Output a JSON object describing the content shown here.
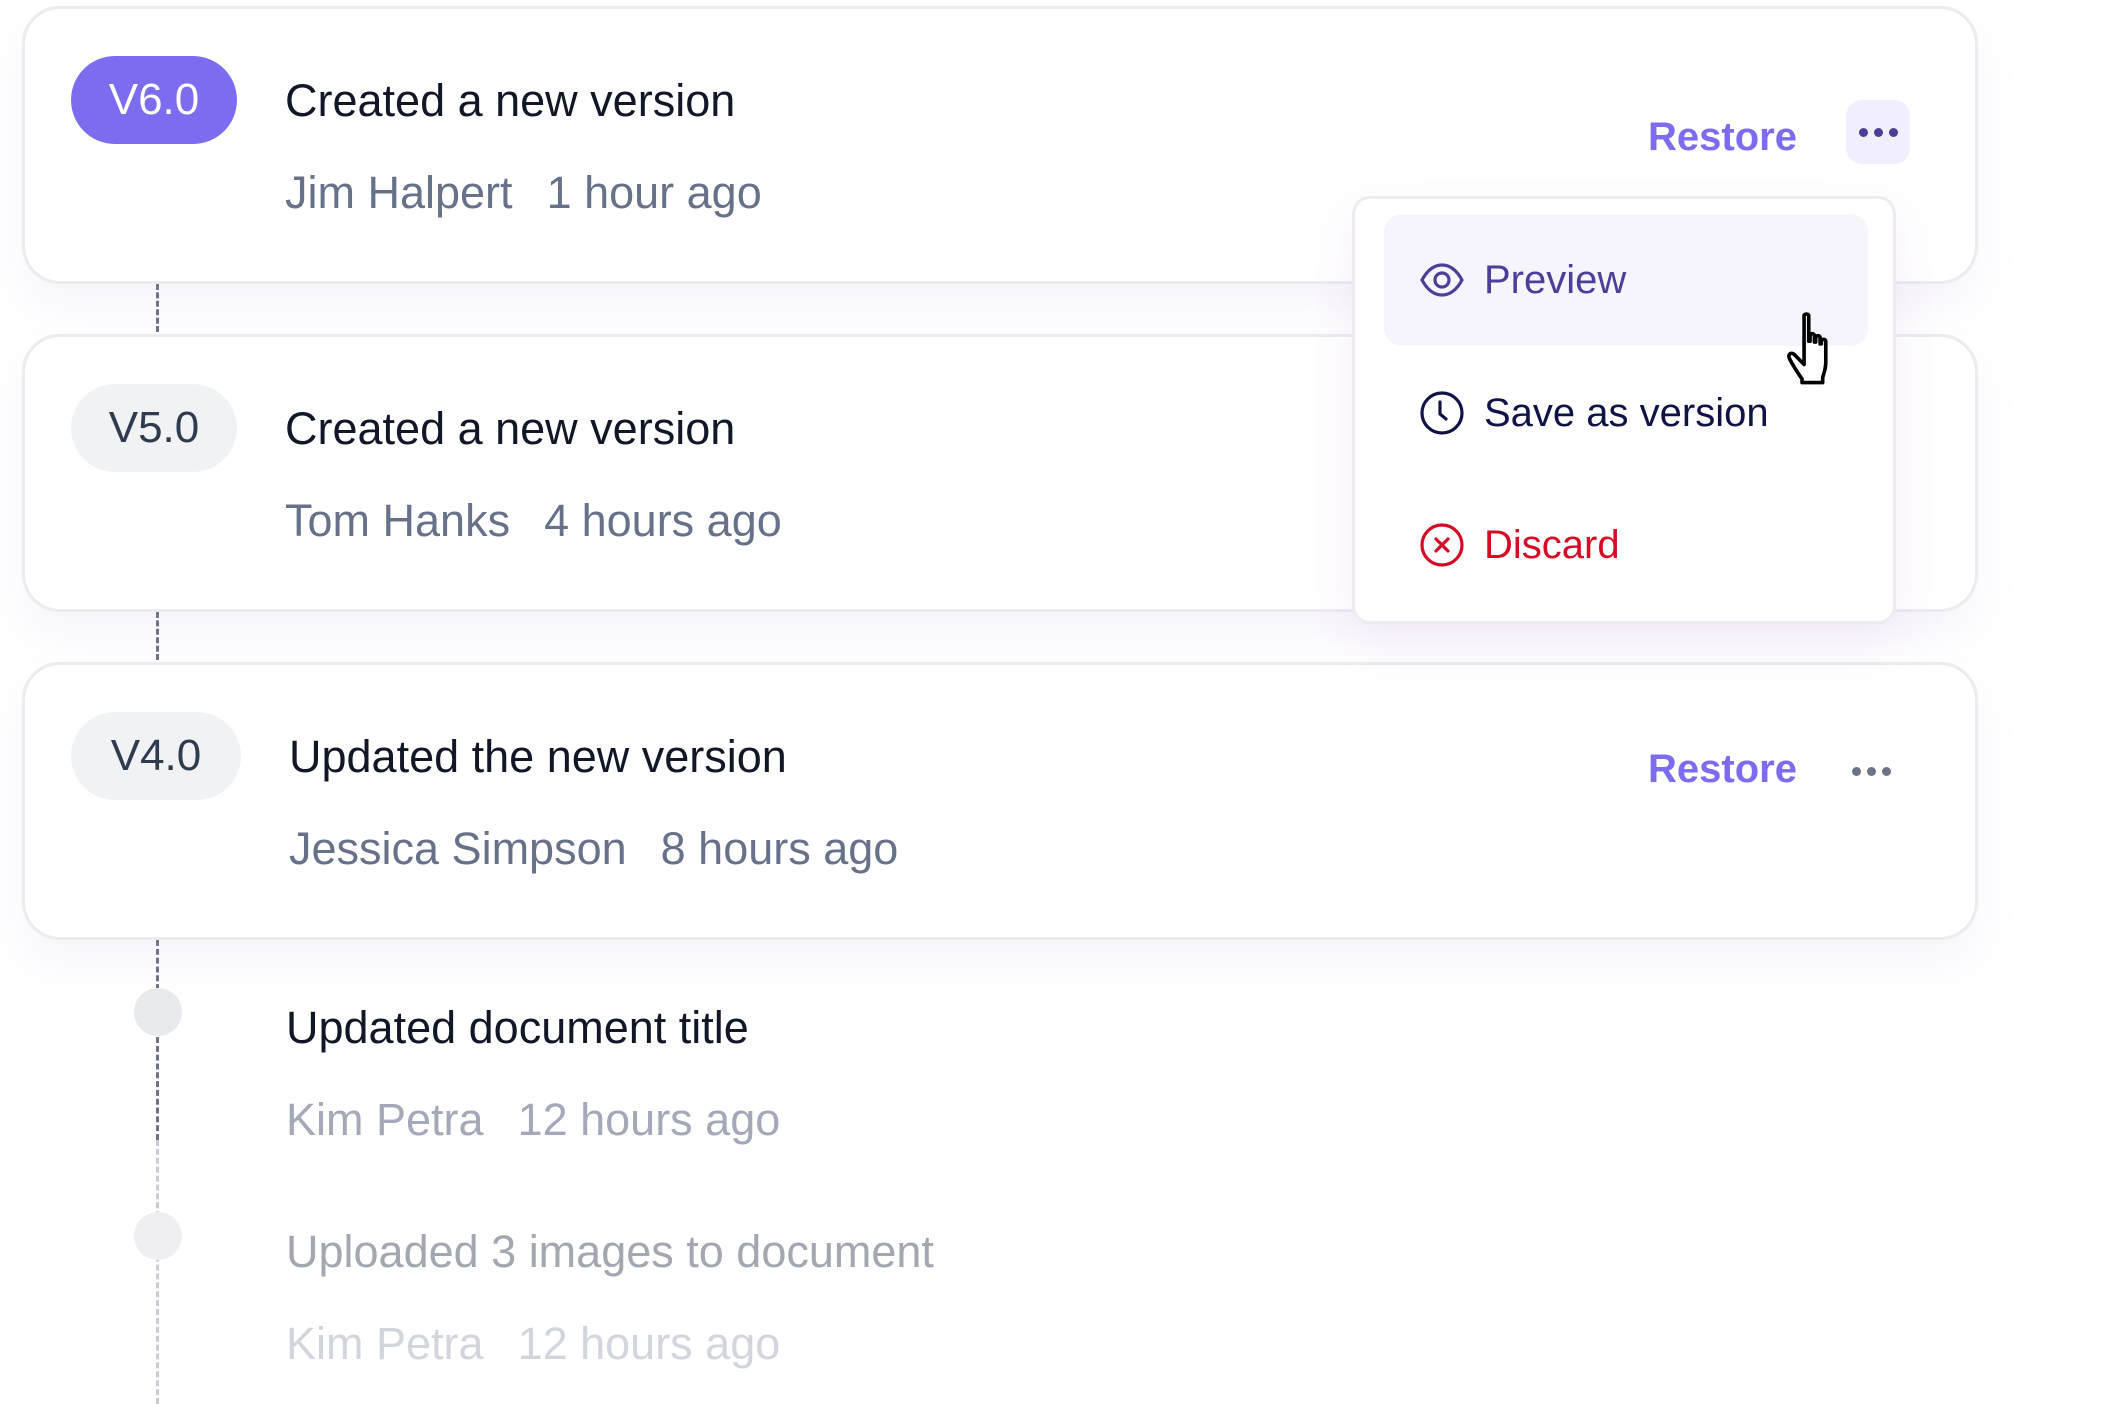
{
  "versions": [
    {
      "badge": "V6.0",
      "title": "Created a new version",
      "author": "Jim Halpert",
      "time": "1 hour ago",
      "restore_label": "Restore",
      "active": true,
      "menu_open": true
    },
    {
      "badge": "V5.0",
      "title": "Created a new version",
      "author": "Tom Hanks",
      "time": "4 hours ago",
      "active": false
    },
    {
      "badge": "V4.0",
      "title": "Updated the new version",
      "author": "Jessica Simpson",
      "time": "8 hours ago",
      "restore_label": "Restore",
      "active": false
    }
  ],
  "events": [
    {
      "title": "Updated document title",
      "author": "Kim Petra",
      "time": "12 hours ago"
    },
    {
      "title": "Uploaded 3 images to document",
      "author": "Kim Petra",
      "time": "12 hours ago"
    }
  ],
  "dropdown": {
    "items": [
      {
        "label": "Preview",
        "icon": "eye-icon",
        "hovered": true
      },
      {
        "label": "Save as version",
        "icon": "clock-icon"
      },
      {
        "label": "Discard",
        "icon": "x-circle-icon"
      }
    ]
  },
  "colors": {
    "accent": "#7b6cf0",
    "danger": "#d70a26",
    "menu_preview": "#4b3f9a",
    "menu_save": "#0f1446",
    "title": "#101828",
    "meta": "#67728a"
  }
}
